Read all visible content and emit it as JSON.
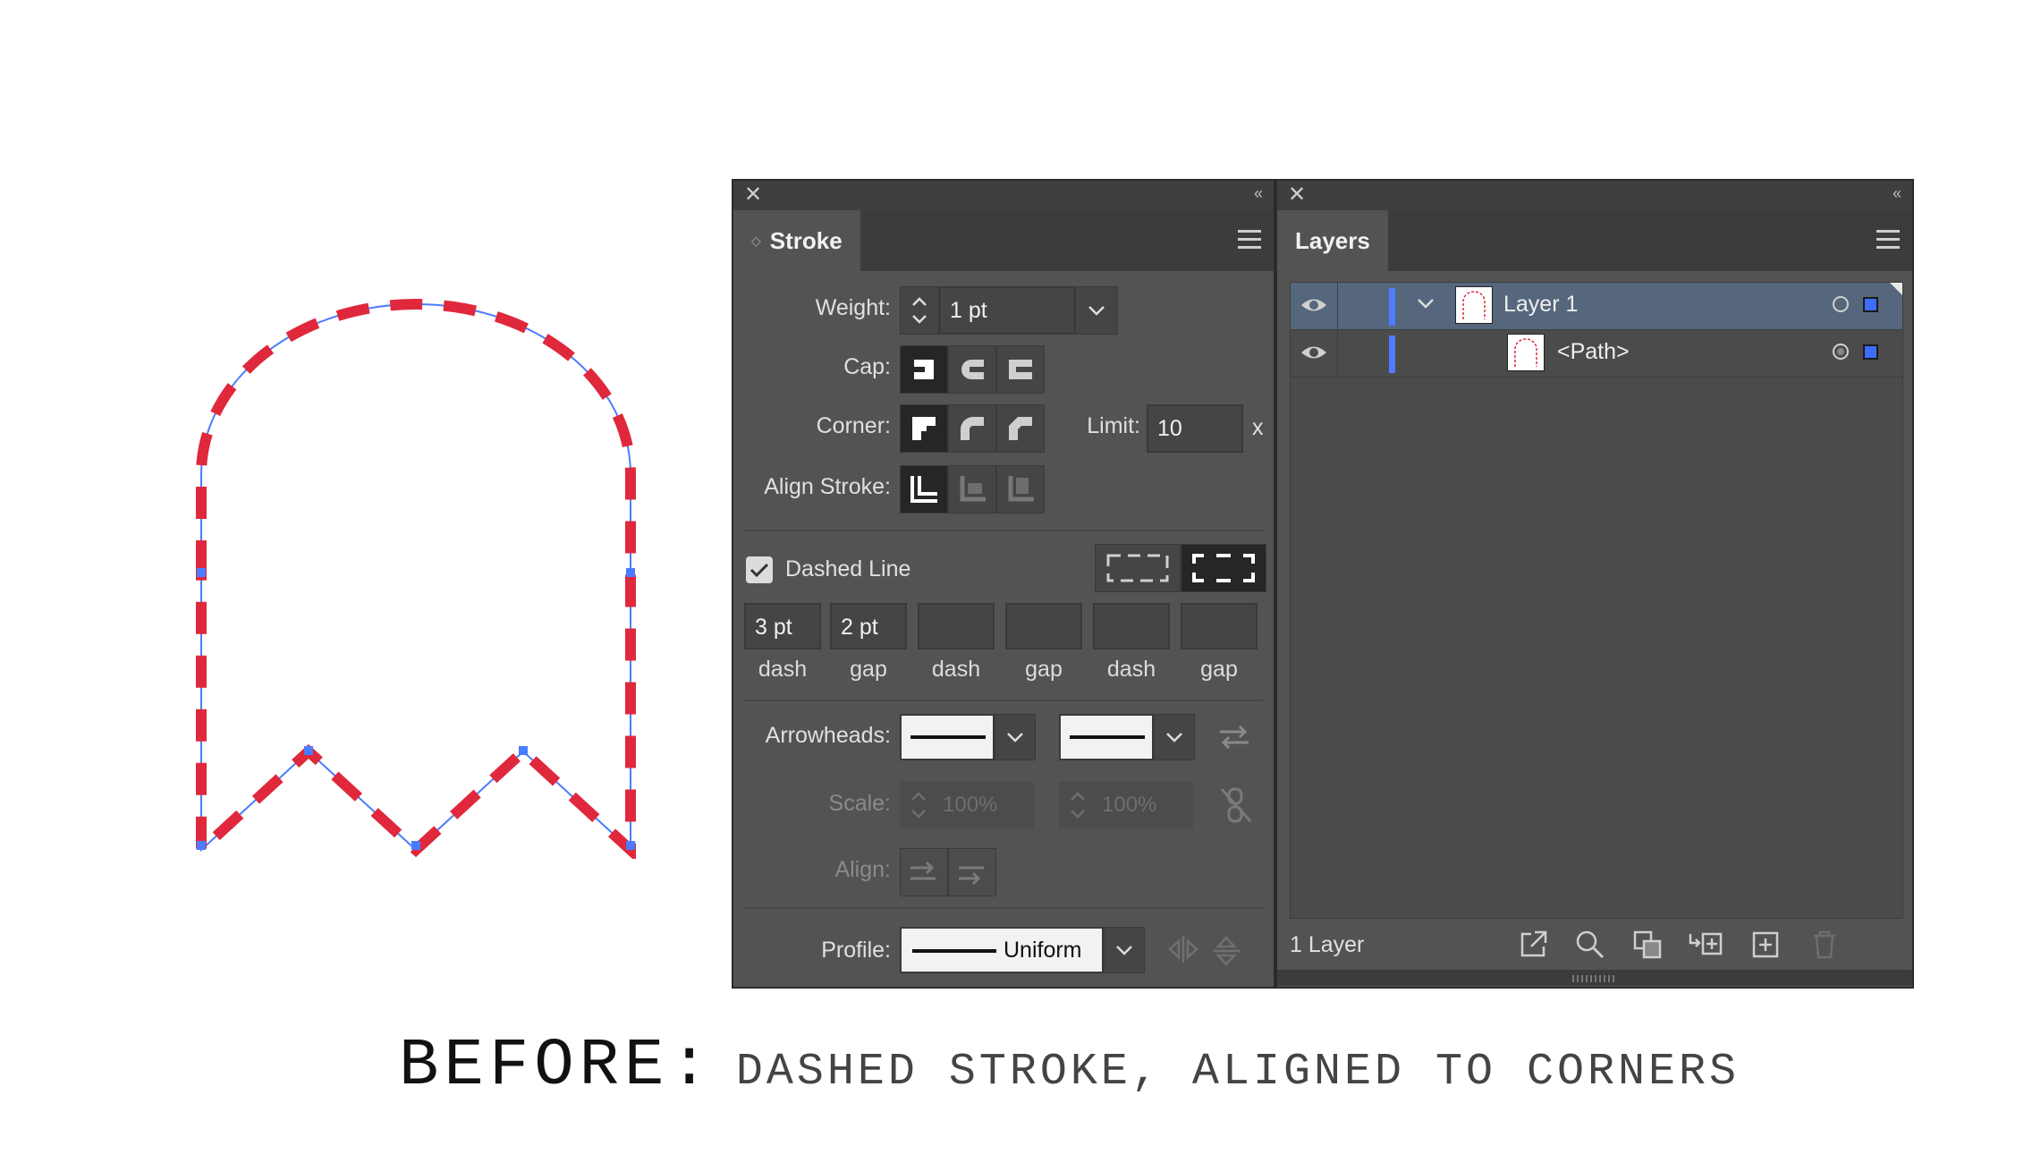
{
  "stroke_panel": {
    "tab": "Stroke",
    "weight_label": "Weight:",
    "weight_value": "1 pt",
    "cap_label": "Cap:",
    "corner_label": "Corner:",
    "limit_label": "Limit:",
    "limit_value": "10",
    "limit_unit": "x",
    "align_stroke_label": "Align Stroke:",
    "dashed_line_label": "Dashed Line",
    "dashed_line_checked": true,
    "dash_gap_fields": [
      {
        "value": "3 pt",
        "label": "dash"
      },
      {
        "value": "2 pt",
        "label": "gap"
      },
      {
        "value": "",
        "label": "dash"
      },
      {
        "value": "",
        "label": "gap"
      },
      {
        "value": "",
        "label": "dash"
      },
      {
        "value": "",
        "label": "gap"
      }
    ],
    "arrowheads_label": "Arrowheads:",
    "scale_label": "Scale:",
    "scale_start": "100%",
    "scale_end": "100%",
    "align_label": "Align:",
    "profile_label": "Profile:",
    "profile_value": "Uniform"
  },
  "layers_panel": {
    "tab": "Layers",
    "rows": [
      {
        "name": "Layer 1"
      },
      {
        "name": "<Path>"
      }
    ],
    "footer": "1 Layer"
  },
  "caption": {
    "main": "BEFORE:",
    "sub": "DASHED STROKE, ALIGNED TO CORNERS"
  },
  "colors": {
    "stroke_red": "#e0283c",
    "path_blue": "#4a7cff",
    "panel_bg": "#535353",
    "layer_selected": "#56677d"
  }
}
